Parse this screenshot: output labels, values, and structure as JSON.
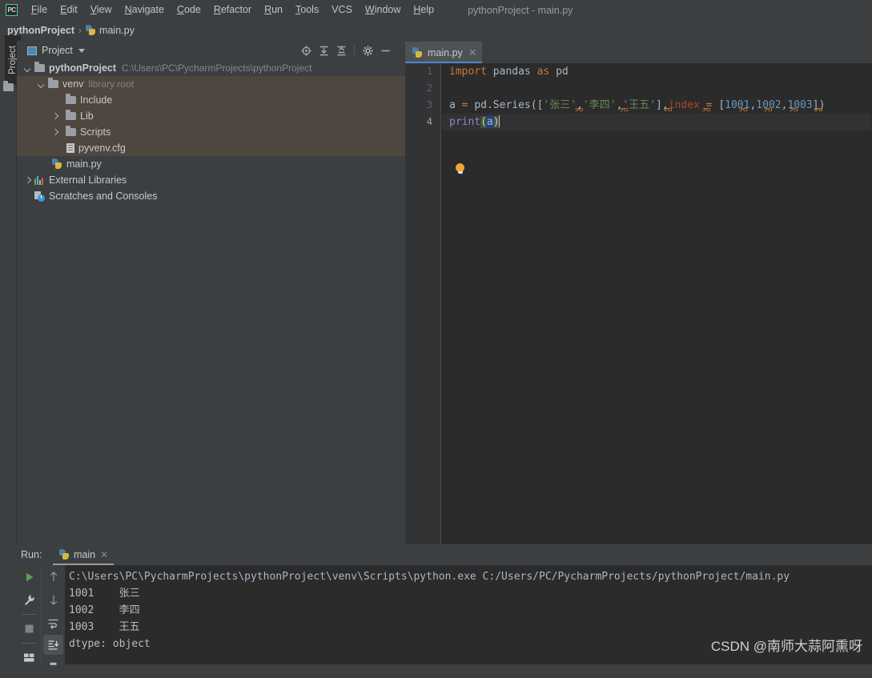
{
  "window": {
    "title": "pythonProject - main.py",
    "logo_text": "PC",
    "logo_icon": "pycharm-logo-icon"
  },
  "menu": {
    "items": [
      {
        "label": "File",
        "mnemonic": "F"
      },
      {
        "label": "Edit",
        "mnemonic": "E"
      },
      {
        "label": "View",
        "mnemonic": "V"
      },
      {
        "label": "Navigate",
        "mnemonic": "N"
      },
      {
        "label": "Code",
        "mnemonic": "C"
      },
      {
        "label": "Refactor",
        "mnemonic": "R"
      },
      {
        "label": "Run",
        "mnemonic": "R"
      },
      {
        "label": "Tools",
        "mnemonic": "T"
      },
      {
        "label": "VCS",
        "mnemonic": ""
      },
      {
        "label": "Window",
        "mnemonic": "W"
      },
      {
        "label": "Help",
        "mnemonic": "H"
      }
    ]
  },
  "breadcrumb": {
    "project": "pythonProject",
    "separator": "›",
    "file": "main.py",
    "file_icon": "python-file-icon"
  },
  "left_stripe": {
    "tool_tab": "Project",
    "folder_icon": "folder-icon"
  },
  "project_panel": {
    "title": "Project",
    "title_icon": "project-view-icon",
    "dropdown_icon": "chevron-down-icon",
    "tools": [
      {
        "name": "locate-icon",
        "tip": "Select Opened File"
      },
      {
        "name": "expand-all-icon",
        "tip": "Expand All"
      },
      {
        "name": "collapse-all-icon",
        "tip": "Collapse All"
      },
      {
        "name": "gear-icon",
        "tip": "Settings"
      },
      {
        "name": "minimize-icon",
        "tip": "Hide"
      }
    ],
    "tree": [
      {
        "label": "pythonProject",
        "hint": "C:\\Users\\PC\\PycharmProjects\\pythonProject",
        "icon": "folder-icon",
        "arrow": "down",
        "depth": 0,
        "bold": true,
        "selected": false
      },
      {
        "label": "venv",
        "hint": "library root",
        "icon": "folder-icon",
        "arrow": "down",
        "depth": 1,
        "bold": false,
        "selected": true
      },
      {
        "label": "Include",
        "hint": "",
        "icon": "folder-icon",
        "arrow": "none",
        "depth": 2,
        "bold": false,
        "selected": true
      },
      {
        "label": "Lib",
        "hint": "",
        "icon": "folder-icon",
        "arrow": "right",
        "depth": 2,
        "bold": false,
        "selected": true
      },
      {
        "label": "Scripts",
        "hint": "",
        "icon": "folder-icon",
        "arrow": "right",
        "depth": 2,
        "bold": false,
        "selected": true
      },
      {
        "label": "pyvenv.cfg",
        "hint": "",
        "icon": "config-file-icon",
        "arrow": "none",
        "depth": 2,
        "bold": false,
        "selected": true
      },
      {
        "label": "main.py",
        "hint": "",
        "icon": "python-file-icon",
        "arrow": "none",
        "depth": 1,
        "bold": false,
        "selected": false
      },
      {
        "label": "External Libraries",
        "hint": "",
        "icon": "libraries-icon",
        "arrow": "right",
        "depth": 0,
        "bold": false,
        "selected": false
      },
      {
        "label": "Scratches and Consoles",
        "hint": "",
        "icon": "scratches-icon",
        "arrow": "none",
        "depth": 0,
        "bold": false,
        "selected": false
      }
    ]
  },
  "editor": {
    "tab": {
      "label": "main.py",
      "icon": "python-file-icon",
      "close_icon": "close-icon",
      "active": true
    },
    "line_numbers": [
      "1",
      "2",
      "3",
      "4"
    ],
    "current_line": 4,
    "intention_icon": "lightbulb-icon",
    "lines": [
      {
        "n": 1,
        "text": "import pandas as pd"
      },
      {
        "n": 2,
        "text": ""
      },
      {
        "n": 3,
        "text": "a = pd.Series(['张三','李四','王五'],index = [1001,1002,1003])"
      },
      {
        "n": 4,
        "text": "print(a)"
      }
    ],
    "tokens": {
      "l1": {
        "kw_import": "import",
        "mod": " pandas ",
        "kw_as": "as",
        "alias": " pd"
      },
      "l3": {
        "var": "a",
        "eq": " = ",
        "call": "pd.Series",
        "open": "([",
        "s1": "'张三'",
        "c1": ",",
        "s2": "'李四'",
        "c2": ",",
        "s3": "'王五'",
        "close_br": "]",
        "c3": ",",
        "kwarg": "index",
        "kweq": " = ",
        "open2": "[",
        "n1": "1001",
        "c4": ",",
        "n2": "1002",
        "c5": ",",
        "n3": "1003",
        "close": "])"
      },
      "l4": {
        "fn": "print",
        "lp": "(",
        "arg": "a",
        "rp": ")"
      }
    }
  },
  "run_panel": {
    "label": "Run:",
    "tab": {
      "label": "main",
      "icon": "python-config-icon",
      "close_icon": "close-icon"
    },
    "left_tools": [
      {
        "name": "rerun-icon",
        "tip": "Rerun"
      },
      {
        "name": "wrench-icon",
        "tip": "Edit Configuration"
      },
      {
        "name": "stop-icon",
        "tip": "Stop"
      },
      {
        "name": "layout-icon",
        "tip": "Layout Settings"
      }
    ],
    "right_tools": [
      {
        "name": "arrow-up-icon",
        "tip": "Previous Occurrence"
      },
      {
        "name": "arrow-down-icon",
        "tip": "Next Occurrence"
      },
      {
        "name": "soft-wrap-icon",
        "tip": "Soft-Wrap"
      },
      {
        "name": "scroll-to-end-icon",
        "tip": "Scroll to End",
        "active": true
      },
      {
        "name": "print-icon",
        "tip": "Print"
      }
    ],
    "console": {
      "command": "C:\\Users\\PC\\PycharmProjects\\pythonProject\\venv\\Scripts\\python.exe C:/Users/PC/PycharmProjects/pythonProject/main.py",
      "rows": [
        {
          "index": "1001",
          "value": "张三"
        },
        {
          "index": "1002",
          "value": "李四"
        },
        {
          "index": "1003",
          "value": "王五"
        }
      ],
      "dtype": "dtype: object"
    }
  },
  "watermark": {
    "text": "CSDN @南师大蒜阿熏呀"
  },
  "colors": {
    "bg_chrome": "#3c3f41",
    "bg_editor": "#2b2b2b",
    "accent_tab": "#4a88c7",
    "tree_selection": "#4e4740",
    "keyword": "#cc7832",
    "string": "#6a8759",
    "number": "#6897bb",
    "named_param": "#aa4926",
    "builtin_fn": "#8888c6",
    "default_text": "#a9b7c6",
    "run_green": "#5b9e4f"
  }
}
